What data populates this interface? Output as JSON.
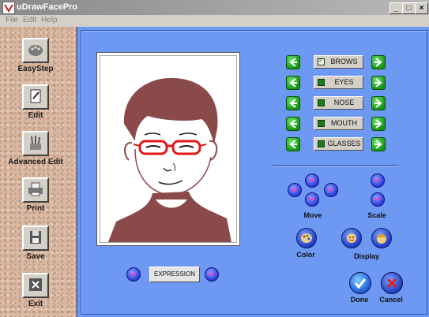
{
  "window": {
    "title": "uDrawFacePro",
    "minimize": "_",
    "maximize": "□",
    "close": "×"
  },
  "menu": [
    "File",
    "Edit",
    "Help"
  ],
  "sidebar": {
    "items": [
      {
        "label": "EasyStep",
        "icon": "palette-icon"
      },
      {
        "label": "Edit",
        "icon": "edit-document-icon"
      },
      {
        "label": "Advanced Edit",
        "icon": "brush-tools-icon"
      },
      {
        "label": "Print",
        "icon": "printer-icon"
      },
      {
        "label": "Save",
        "icon": "floppy-disk-icon"
      },
      {
        "label": "Exit",
        "icon": "exit-x-icon"
      }
    ]
  },
  "features": [
    {
      "label": "BROWS",
      "checked": true
    },
    {
      "label": "EYES",
      "checked": false
    },
    {
      "label": "NOSE",
      "checked": false
    },
    {
      "label": "MOUTH",
      "checked": false
    },
    {
      "label": "GLASSES",
      "checked": false
    }
  ],
  "controls": {
    "move_label": "Move",
    "scale_label": "Scale",
    "color_label": "Color",
    "display_label": "Display",
    "expression_label": "EXPRESSION",
    "done_label": "Done",
    "cancel_label": "Cancel"
  },
  "colors": {
    "panel_blue": "#6d99f2",
    "hair_brown": "#8b4a4a",
    "glasses_red": "#e01818",
    "arrow_green": "#119511"
  }
}
